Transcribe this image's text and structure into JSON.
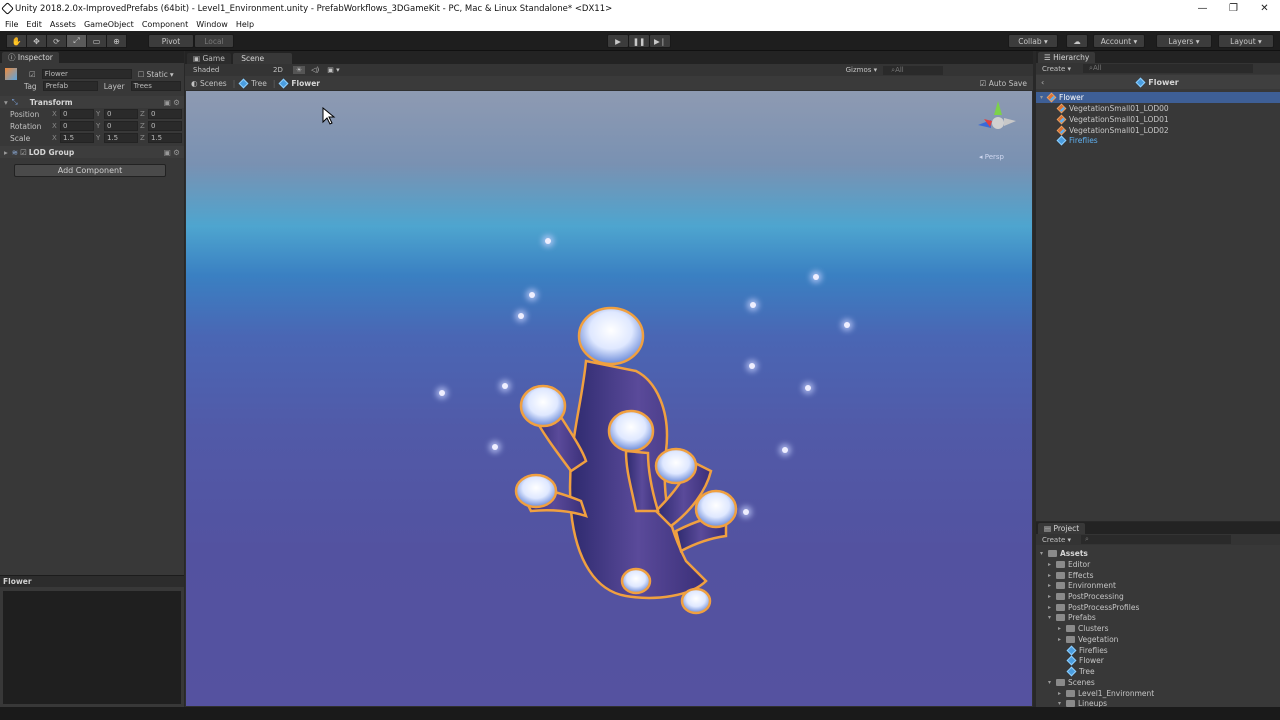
{
  "window": {
    "title": "Unity 2018.2.0x-ImprovedPrefabs (64bit) - Level1_Environment.unity - PrefabWorkflows_3DGameKit - PC, Mac & Linux Standalone* <DX11>",
    "controls": [
      "—",
      "❐",
      "✕"
    ]
  },
  "menu": [
    "File",
    "Edit",
    "Assets",
    "GameObject",
    "Component",
    "Window",
    "Help"
  ],
  "toolbar": {
    "tools": [
      "✋",
      "✥",
      "⟳",
      "⤢",
      "▭",
      "⊕"
    ],
    "pivot": "Pivot",
    "local": "Local",
    "collab": "Collab",
    "account": "Account",
    "layers": "Layers",
    "layout": "Layout"
  },
  "inspector": {
    "tab": "Inspector",
    "object_name": "Flower",
    "static_label": "Static",
    "tag_label": "Tag",
    "tag_value": "Prefab",
    "layer_label": "Layer",
    "layer_value": "Trees",
    "transform_title": "Transform",
    "position_label": "Position",
    "rotation_label": "Rotation",
    "scale_label": "Scale",
    "axes": [
      "X",
      "Y",
      "Z"
    ],
    "position": [
      "0",
      "0",
      "0"
    ],
    "rotation": [
      "0",
      "0",
      "0"
    ],
    "scale": [
      "1.5",
      "1.5",
      "1.5"
    ],
    "lod_title": "LOD Group",
    "add_component": "Add Component",
    "preview_title": "Flower"
  },
  "scene": {
    "tab_game": "Game",
    "tab_scene": "Scene",
    "shading": "Shaded",
    "mode_2d": "2D",
    "gizmos": "Gizmos",
    "search_all": "All",
    "breadcrumb": [
      "Scenes",
      "Tree",
      "Flower"
    ],
    "auto_save": "Auto Save",
    "persp_label": "Persp"
  },
  "hierarchy": {
    "tab": "Hierarchy",
    "create": "Create",
    "search_all": "All",
    "header": "Flower",
    "root": "Flower",
    "children": [
      "VegetationSmall01_LOD00",
      "VegetationSmall01_LOD01",
      "VegetationSmall01_LOD02",
      "Fireflies"
    ]
  },
  "project": {
    "tab": "Project",
    "create": "Create",
    "root": "Assets",
    "folders": [
      "Editor",
      "Effects",
      "Environment",
      "PostProcessing",
      "PostProcessProfiles",
      "Prefabs"
    ],
    "prefab_children": [
      "Clusters",
      "Vegetation"
    ],
    "prefab_assets": [
      "Fireflies",
      "Flower",
      "Tree"
    ],
    "scenes_folder": "Scenes",
    "scene_children": [
      "Level1_Environment",
      "Lineups"
    ]
  },
  "colors": {
    "accent_selection": "#3e5f96",
    "selection_outline": "#f0a040",
    "flower_cap": "#dfe8ff"
  }
}
